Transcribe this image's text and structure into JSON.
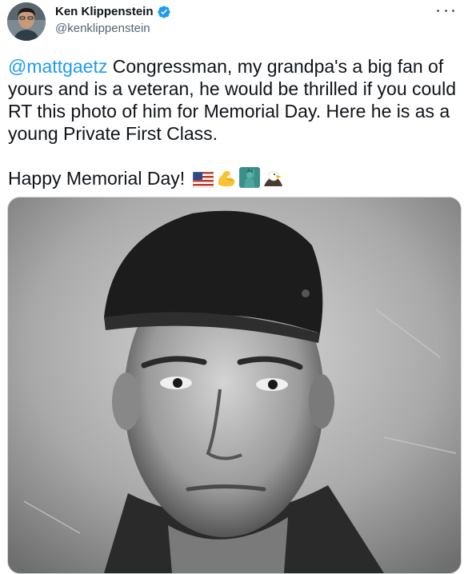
{
  "author": {
    "display_name": "Ken Klippenstein",
    "handle": "@kenklippenstein",
    "verified": true
  },
  "tweet": {
    "mention": "@mattgaetz",
    "text_main": " Congressman, my grandpa's a big fan of yours and is a veteran, he would be thrilled if you could RT this photo of him for Memorial Day. Here he is as a young Private First Class.",
    "text_closing": "Happy Memorial Day! ",
    "emojis": [
      "flag-us-icon",
      "flexed-biceps-icon",
      "statue-of-liberty-icon",
      "eagle-icon"
    ]
  },
  "colors": {
    "accent": "#1d9bf0",
    "text": "#0f1419",
    "muted": "#536471",
    "border": "#cfd9de"
  },
  "icons": {
    "verified": "verified-badge-icon",
    "more": "more-options-icon"
  }
}
